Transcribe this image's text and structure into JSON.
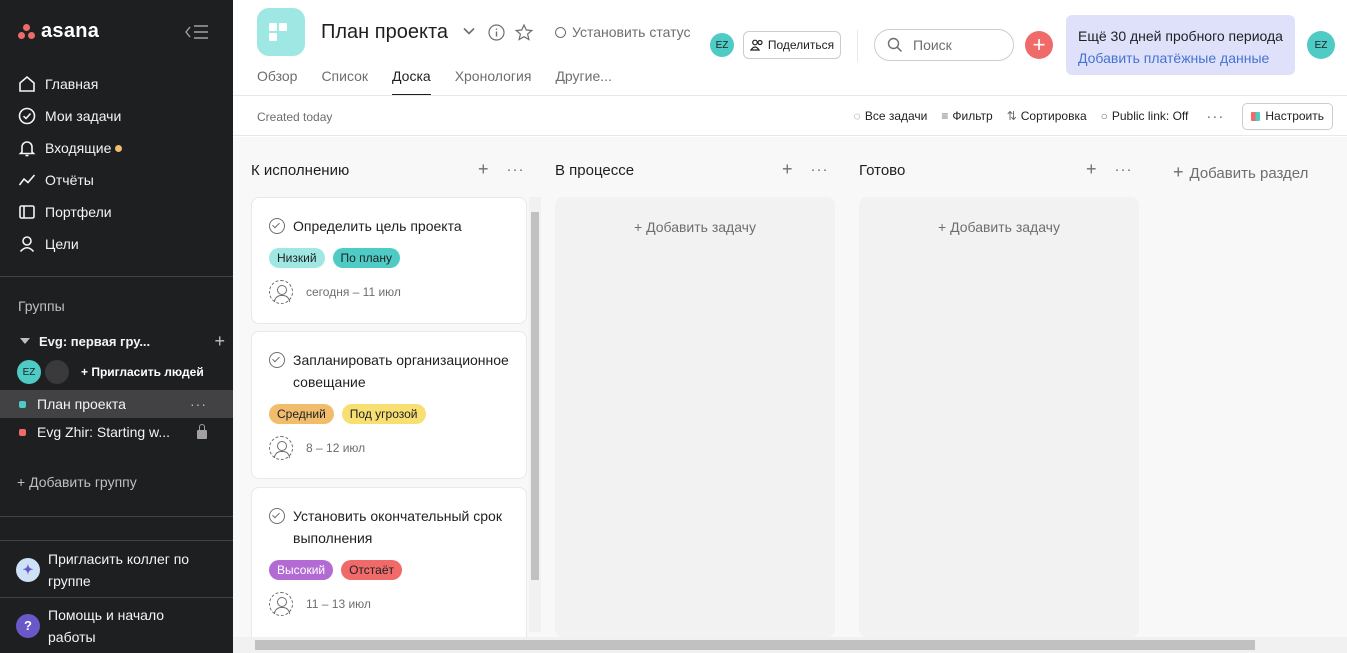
{
  "sidebar": {
    "logo": "asana",
    "nav": [
      {
        "label": "Главная",
        "icon": "home-icon"
      },
      {
        "label": "Мои задачи",
        "icon": "check-circle-icon"
      },
      {
        "label": "Входящие",
        "icon": "bell-icon"
      },
      {
        "label": "Отчёты",
        "icon": "reports-icon"
      },
      {
        "label": "Портфели",
        "icon": "folder-icon"
      },
      {
        "label": "Цели",
        "icon": "goals-icon"
      }
    ],
    "groups_title": "Группы",
    "team_name": "Evg: первая гру...",
    "member_initials": "EZ",
    "invite_people": "Пригласить людей",
    "projects": [
      {
        "name": "План проекта",
        "color": "#4ecbc4"
      },
      {
        "name": "Evg Zhir: Starting w...",
        "color": "#f06a6a"
      }
    ],
    "add_group": "+ Добавить группу",
    "invite_colleagues": "Пригласить коллег по группе",
    "help": "Помощь и начало работы"
  },
  "header": {
    "project_title": "План проекта",
    "set_status": "Установить статус",
    "user_initials": "EZ",
    "share_label": "Поделиться",
    "search_placeholder": "Поиск",
    "trial_line1": "Ещё 30 дней пробного периода",
    "trial_line2": "Добавить платёжные данные",
    "tabs": [
      "Обзор",
      "Список",
      "Доска",
      "Хронология",
      "Другие..."
    ],
    "active_tab": "Доска"
  },
  "toolbar": {
    "created": "Created today",
    "all_tasks": "Все задачи",
    "filter": "Фильтр",
    "sort": "Сортировка",
    "public_link": "Public link: Off",
    "customize": "Настроить"
  },
  "board": {
    "columns": [
      {
        "title": "К исполнению"
      },
      {
        "title": "В процессе",
        "add_task": "+ Добавить задачу"
      },
      {
        "title": "Готово",
        "add_task": "+ Добавить задачу"
      }
    ],
    "add_section": "Добавить раздел",
    "cards": [
      {
        "title": "Определить цель проекта",
        "tags": [
          {
            "label": "Низкий",
            "bg": "#9ee7e3",
            "fg": "#1e1f21"
          },
          {
            "label": "По плану",
            "bg": "#4ecbc4",
            "fg": "#1e1f21"
          }
        ],
        "date": "сегодня – 11 июл"
      },
      {
        "title": "Запланировать организационное совещание",
        "tags": [
          {
            "label": "Средний",
            "bg": "#f1bd6c",
            "fg": "#1e1f21"
          },
          {
            "label": "Под угрозой",
            "bg": "#f8df72",
            "fg": "#1e1f21"
          }
        ],
        "date": "8 – 12 июл"
      },
      {
        "title": "Установить окончательный срок выполнения",
        "tags": [
          {
            "label": "Высокий",
            "bg": "#b36bd4",
            "fg": "#ffffff"
          },
          {
            "label": "Отстаёт",
            "bg": "#f06a6a",
            "fg": "#1e1f21"
          }
        ],
        "date": "11 – 13 июл"
      }
    ]
  }
}
